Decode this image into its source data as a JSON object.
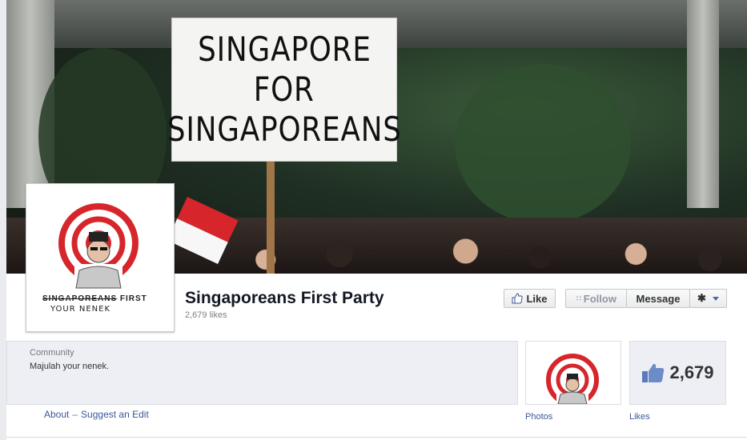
{
  "cover": {
    "sign_lines": [
      "SINGAPORE",
      "FOR",
      "SINGAPOREANS"
    ]
  },
  "profile": {
    "logo_line1_struck": "SINGAPOREANS",
    "logo_line1_rest": "FIRST",
    "logo_line2": "YOUR NENEK"
  },
  "page": {
    "name": "Singaporeans First Party",
    "likes_text": "2,679 likes"
  },
  "actions": {
    "like_label": "Like",
    "follow_label": "Follow",
    "message_label": "Message",
    "gear_icon": "gear-icon"
  },
  "about": {
    "category": "Community",
    "description": "Majulah your nenek.",
    "about_link": "About",
    "separator": "–",
    "suggest_link": "Suggest an Edit"
  },
  "tiles": {
    "photos_label": "Photos",
    "likes_count": "2,679",
    "likes_label": "Likes"
  },
  "colors": {
    "link": "#3b5998",
    "target_red": "#d6262b",
    "panel_bg": "#edeff4"
  }
}
